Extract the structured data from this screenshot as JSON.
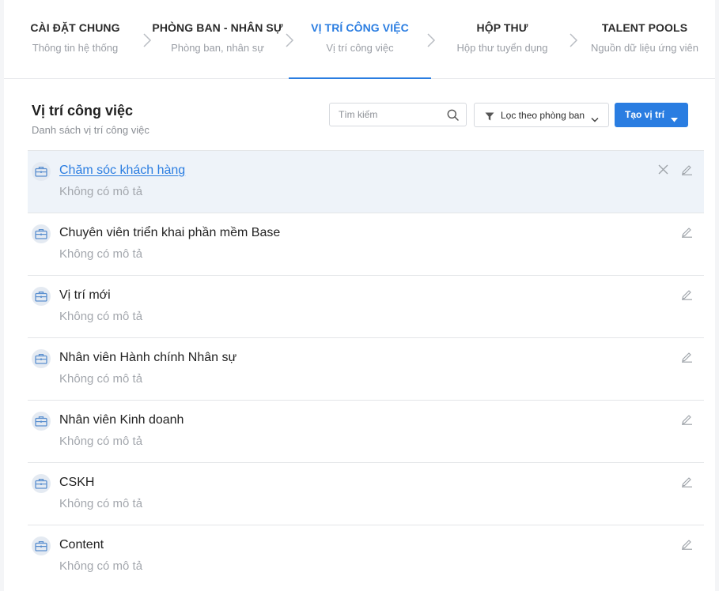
{
  "steps": [
    {
      "title": "CÀI ĐẶT CHUNG",
      "subtitle": "Thông tin hệ thống"
    },
    {
      "title": "PHÒNG BAN - NHÂN SỰ",
      "subtitle": "Phòng ban, nhân sự"
    },
    {
      "title": "VỊ TRÍ CÔNG VIỆC",
      "subtitle": "Vị trí công việc"
    },
    {
      "title": "HỘP THƯ",
      "subtitle": "Hộp thư tuyển dụng"
    },
    {
      "title": "TALENT POOLS",
      "subtitle": "Nguồn dữ liệu ứng viên"
    }
  ],
  "active_step": "VỊ TRÍ CÔNG VIỆC",
  "header": {
    "title": "Vị trí công việc",
    "subtitle": "Danh sách vị trí công việc"
  },
  "search": {
    "placeholder": "Tìm kiếm",
    "value": "",
    "icon": "search-icon"
  },
  "filter": {
    "label": "Lọc theo phòng ban",
    "icon": "filter-icon"
  },
  "create_button": {
    "label": "Tạo vị trí"
  },
  "positions": [
    {
      "title": "Chăm sóc khách hàng",
      "description": "Không có mô tả"
    },
    {
      "title": "Chuyên viên triển khai phần mềm Base",
      "description": "Không có mô tả"
    },
    {
      "title": "Vị trí mới",
      "description": "Không có mô tả"
    },
    {
      "title": "Nhân viên Hành chính Nhân sự",
      "description": "Không có mô tả"
    },
    {
      "title": "Nhân viên Kinh doanh",
      "description": "Không có mô tả"
    },
    {
      "title": "CSKH",
      "description": "Không có mô tả"
    },
    {
      "title": "Content",
      "description": "Không có mô tả"
    }
  ],
  "hovered_position": "Chăm sóc khách hàng",
  "colors": {
    "accent": "#2a7de1",
    "hover_row": "#eef3f9",
    "muted_text": "#a3a7ad",
    "icon_bg": "#e4eaf2"
  }
}
